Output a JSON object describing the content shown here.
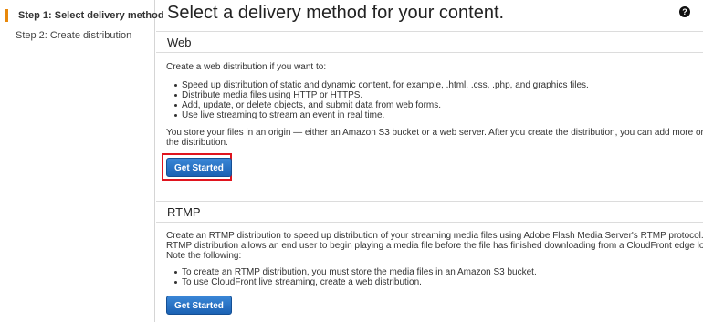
{
  "sidebar": {
    "steps": [
      {
        "label": "Step 1: Select delivery method"
      },
      {
        "label": "Step 2: Create distribution"
      }
    ]
  },
  "main": {
    "title": "Select a delivery method for your content.",
    "help_icon": "question-circle-icon"
  },
  "web": {
    "title": "Web",
    "intro": "Create a web distribution if you want to:",
    "bullets": [
      "Speed up distribution of static and dynamic content, for example, .html, .css, .php, and graphics files.",
      "Distribute media files using HTTP or HTTPS.",
      "Add, update, or delete objects, and submit data from web forms.",
      "Use live streaming to stream an event in real time."
    ],
    "origin_line1": "You store your files in an origin — either an Amazon S3 bucket or a web server. After you create the distribution, you can add more origins to",
    "origin_line2": "the distribution.",
    "button": "Get Started"
  },
  "rtmp": {
    "title": "RTMP",
    "line1": "Create an RTMP distribution to speed up distribution of your streaming media files using Adobe Flash Media Server's RTMP protocol. An",
    "line2": "RTMP distribution allows an end user to begin playing a media file before the file has finished downloading from a CloudFront edge location.",
    "line3": "Note the following:",
    "bullets": [
      "To create an RTMP distribution, you must store the media files in an Amazon S3 bucket.",
      "To use CloudFront live streaming, create a web distribution."
    ],
    "button": "Get Started"
  },
  "colors": {
    "accent_orange": "#e8880b",
    "button_blue": "#1b62b4",
    "highlight_red": "#e0141e"
  }
}
